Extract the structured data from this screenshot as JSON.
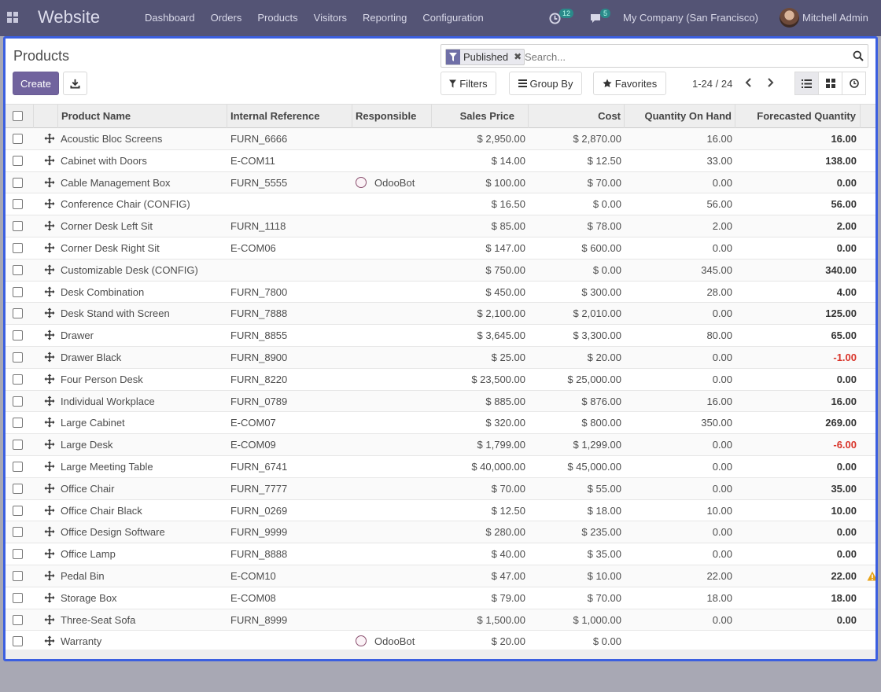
{
  "navbar": {
    "app_title": "Website",
    "menu": [
      "Dashboard",
      "Orders",
      "Products",
      "Visitors",
      "Reporting",
      "Configuration"
    ],
    "activity_count": "12",
    "message_count": "5",
    "company": "My Company (San Francisco)",
    "user": "Mitchell Admin"
  },
  "page": {
    "title": "Products",
    "create_label": "Create",
    "facet_label": "Published",
    "search_placeholder": "Search...",
    "filters_label": "Filters",
    "groupby_label": "Group By",
    "favorites_label": "Favorites",
    "pager": "1-24 / 24"
  },
  "table": {
    "headers": [
      "Product Name",
      "Internal Reference",
      "Responsible",
      "Sales Price",
      "Cost",
      "Quantity On Hand",
      "Forecasted Quantity"
    ],
    "rows": [
      {
        "name": "Acoustic Bloc Screens",
        "ref": "FURN_6666",
        "resp": "",
        "price": "$ 2,950.00",
        "cost": "$ 2,870.00",
        "qty": "16.00",
        "forecast": "16.00",
        "neg": false,
        "warn": false
      },
      {
        "name": "Cabinet with Doors",
        "ref": "E-COM11",
        "resp": "",
        "price": "$ 14.00",
        "cost": "$ 12.50",
        "qty": "33.00",
        "forecast": "138.00",
        "neg": false,
        "warn": false
      },
      {
        "name": "Cable Management Box",
        "ref": "FURN_5555",
        "resp": "OdooBot",
        "price": "$ 100.00",
        "cost": "$ 70.00",
        "qty": "0.00",
        "forecast": "0.00",
        "neg": false,
        "warn": false
      },
      {
        "name": "Conference Chair (CONFIG)",
        "ref": "",
        "resp": "",
        "price": "$ 16.50",
        "cost": "$ 0.00",
        "qty": "56.00",
        "forecast": "56.00",
        "neg": false,
        "warn": false
      },
      {
        "name": "Corner Desk Left Sit",
        "ref": "FURN_1118",
        "resp": "",
        "price": "$ 85.00",
        "cost": "$ 78.00",
        "qty": "2.00",
        "forecast": "2.00",
        "neg": false,
        "warn": false
      },
      {
        "name": "Corner Desk Right Sit",
        "ref": "E-COM06",
        "resp": "",
        "price": "$ 147.00",
        "cost": "$ 600.00",
        "qty": "0.00",
        "forecast": "0.00",
        "neg": false,
        "warn": false
      },
      {
        "name": "Customizable Desk (CONFIG)",
        "ref": "",
        "resp": "",
        "price": "$ 750.00",
        "cost": "$ 0.00",
        "qty": "345.00",
        "forecast": "340.00",
        "neg": false,
        "warn": false
      },
      {
        "name": "Desk Combination",
        "ref": "FURN_7800",
        "resp": "",
        "price": "$ 450.00",
        "cost": "$ 300.00",
        "qty": "28.00",
        "forecast": "4.00",
        "neg": false,
        "warn": false
      },
      {
        "name": "Desk Stand with Screen",
        "ref": "FURN_7888",
        "resp": "",
        "price": "$ 2,100.00",
        "cost": "$ 2,010.00",
        "qty": "0.00",
        "forecast": "125.00",
        "neg": false,
        "warn": false
      },
      {
        "name": "Drawer",
        "ref": "FURN_8855",
        "resp": "",
        "price": "$ 3,645.00",
        "cost": "$ 3,300.00",
        "qty": "80.00",
        "forecast": "65.00",
        "neg": false,
        "warn": false
      },
      {
        "name": "Drawer Black",
        "ref": "FURN_8900",
        "resp": "",
        "price": "$ 25.00",
        "cost": "$ 20.00",
        "qty": "0.00",
        "forecast": "-1.00",
        "neg": true,
        "warn": false
      },
      {
        "name": "Four Person Desk",
        "ref": "FURN_8220",
        "resp": "",
        "price": "$ 23,500.00",
        "cost": "$ 25,000.00",
        "qty": "0.00",
        "forecast": "0.00",
        "neg": false,
        "warn": false
      },
      {
        "name": "Individual Workplace",
        "ref": "FURN_0789",
        "resp": "",
        "price": "$ 885.00",
        "cost": "$ 876.00",
        "qty": "16.00",
        "forecast": "16.00",
        "neg": false,
        "warn": false
      },
      {
        "name": "Large Cabinet",
        "ref": "E-COM07",
        "resp": "",
        "price": "$ 320.00",
        "cost": "$ 800.00",
        "qty": "350.00",
        "forecast": "269.00",
        "neg": false,
        "warn": false
      },
      {
        "name": "Large Desk",
        "ref": "E-COM09",
        "resp": "",
        "price": "$ 1,799.00",
        "cost": "$ 1,299.00",
        "qty": "0.00",
        "forecast": "-6.00",
        "neg": true,
        "warn": false
      },
      {
        "name": "Large Meeting Table",
        "ref": "FURN_6741",
        "resp": "",
        "price": "$ 40,000.00",
        "cost": "$ 45,000.00",
        "qty": "0.00",
        "forecast": "0.00",
        "neg": false,
        "warn": false
      },
      {
        "name": "Office Chair",
        "ref": "FURN_7777",
        "resp": "",
        "price": "$ 70.00",
        "cost": "$ 55.00",
        "qty": "0.00",
        "forecast": "35.00",
        "neg": false,
        "warn": false
      },
      {
        "name": "Office Chair Black",
        "ref": "FURN_0269",
        "resp": "",
        "price": "$ 12.50",
        "cost": "$ 18.00",
        "qty": "10.00",
        "forecast": "10.00",
        "neg": false,
        "warn": false
      },
      {
        "name": "Office Design Software",
        "ref": "FURN_9999",
        "resp": "",
        "price": "$ 280.00",
        "cost": "$ 235.00",
        "qty": "0.00",
        "forecast": "0.00",
        "neg": false,
        "warn": false
      },
      {
        "name": "Office Lamp",
        "ref": "FURN_8888",
        "resp": "",
        "price": "$ 40.00",
        "cost": "$ 35.00",
        "qty": "0.00",
        "forecast": "0.00",
        "neg": false,
        "warn": false
      },
      {
        "name": "Pedal Bin",
        "ref": "E-COM10",
        "resp": "",
        "price": "$ 47.00",
        "cost": "$ 10.00",
        "qty": "22.00",
        "forecast": "22.00",
        "neg": false,
        "warn": true
      },
      {
        "name": "Storage Box",
        "ref": "E-COM08",
        "resp": "",
        "price": "$ 79.00",
        "cost": "$ 70.00",
        "qty": "18.00",
        "forecast": "18.00",
        "neg": false,
        "warn": false
      },
      {
        "name": "Three-Seat Sofa",
        "ref": "FURN_8999",
        "resp": "",
        "price": "$ 1,500.00",
        "cost": "$ 1,000.00",
        "qty": "0.00",
        "forecast": "0.00",
        "neg": false,
        "warn": false
      },
      {
        "name": "Warranty",
        "ref": "",
        "resp": "OdooBot",
        "price": "$ 20.00",
        "cost": "$ 0.00",
        "qty": "",
        "forecast": "",
        "neg": false,
        "warn": false
      }
    ]
  },
  "colors": {
    "navbar": "#545475",
    "primary": "#71639e",
    "focus_border": "#3b5fe0",
    "negative": "#d9352b"
  }
}
